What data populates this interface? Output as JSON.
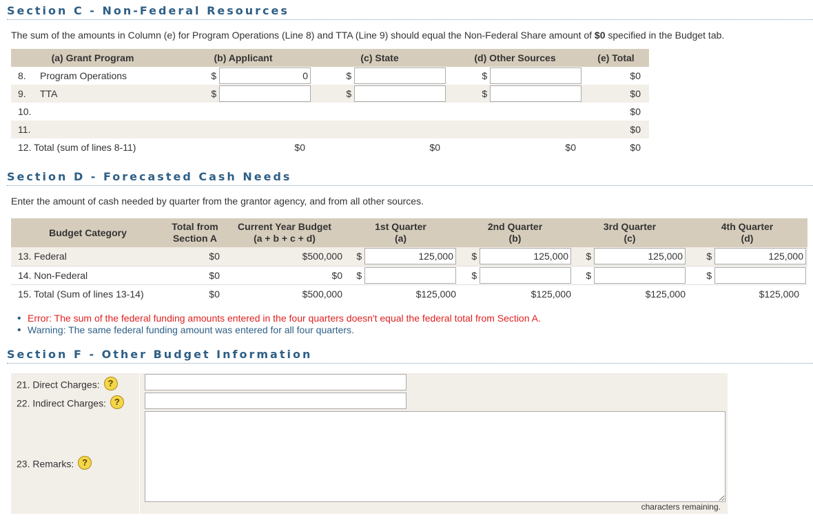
{
  "sectionC": {
    "title": "Section C - Non-Federal Resources",
    "intro_before": "The sum of the amounts in Column (e) for Program Operations (Line 8) and TTA (Line 9) should equal the Non-Federal Share amount of ",
    "intro_amount": "$0",
    "intro_after": " specified in the Budget tab.",
    "headers": [
      "(a) Grant Program",
      "(b) Applicant",
      "(c) State",
      "(d) Other Sources",
      "(e) Total"
    ],
    "rows": [
      {
        "num": "8.",
        "program": "Program Operations",
        "applicant": "0",
        "state": "",
        "other": "",
        "total": "$0"
      },
      {
        "num": "9.",
        "program": "TTA",
        "applicant": "",
        "state": "",
        "other": "",
        "total": "$0"
      },
      {
        "num": "10.",
        "program": "",
        "total": "$0"
      },
      {
        "num": "11.",
        "program": "",
        "total": "$0"
      }
    ],
    "total_row": {
      "label": "12. Total (sum of lines 8-11)",
      "applicant": "$0",
      "state": "$0",
      "other": "$0",
      "total": "$0"
    },
    "dollar_sign": "$"
  },
  "sectionD": {
    "title": "Section D - Forecasted Cash Needs",
    "intro": "Enter the amount of cash needed by quarter from the grantor agency, and from all other sources.",
    "headers": {
      "category": "Budget Category",
      "totalA_1": "Total from",
      "totalA_2": "Section A",
      "cyb_1": "Current Year Budget",
      "cyb_2": "(a + b + c + d)",
      "q1_1": "1st Quarter",
      "q1_2": "(a)",
      "q2_1": "2nd Quarter",
      "q2_2": "(b)",
      "q3_1": "3rd Quarter",
      "q3_2": "(c)",
      "q4_1": "4th Quarter",
      "q4_2": "(d)"
    },
    "rows": [
      {
        "label": "13. Federal",
        "totalA": "$0",
        "cyb": "$500,000",
        "q1": "125,000",
        "q2": "125,000",
        "q3": "125,000",
        "q4": "125,000"
      },
      {
        "label": "14. Non-Federal",
        "totalA": "$0",
        "cyb": "$0",
        "q1": "",
        "q2": "",
        "q3": "",
        "q4": ""
      }
    ],
    "total_row": {
      "label": "15. Total (Sum of lines 13-14)",
      "totalA": "$0",
      "cyb": "$500,000",
      "q1": "$125,000",
      "q2": "$125,000",
      "q3": "$125,000",
      "q4": "$125,000"
    },
    "messages": {
      "error": "Error: The sum of the federal funding amounts entered in the four quarters doesn't equal the federal total from Section A.",
      "warning": "Warning: The same federal funding amount was entered for all four quarters."
    },
    "dollar_sign": "$"
  },
  "sectionF": {
    "title": "Section F - Other Budget Information",
    "direct_label": "21. Direct Charges:",
    "indirect_label": "22. Indirect Charges:",
    "remarks_label": "23. Remarks:",
    "chars_remaining": "characters remaining.",
    "help_glyph": "?",
    "help_icon": "question-help-icon",
    "error_color": "#e02020",
    "accent_color": "#2e5f86"
  }
}
